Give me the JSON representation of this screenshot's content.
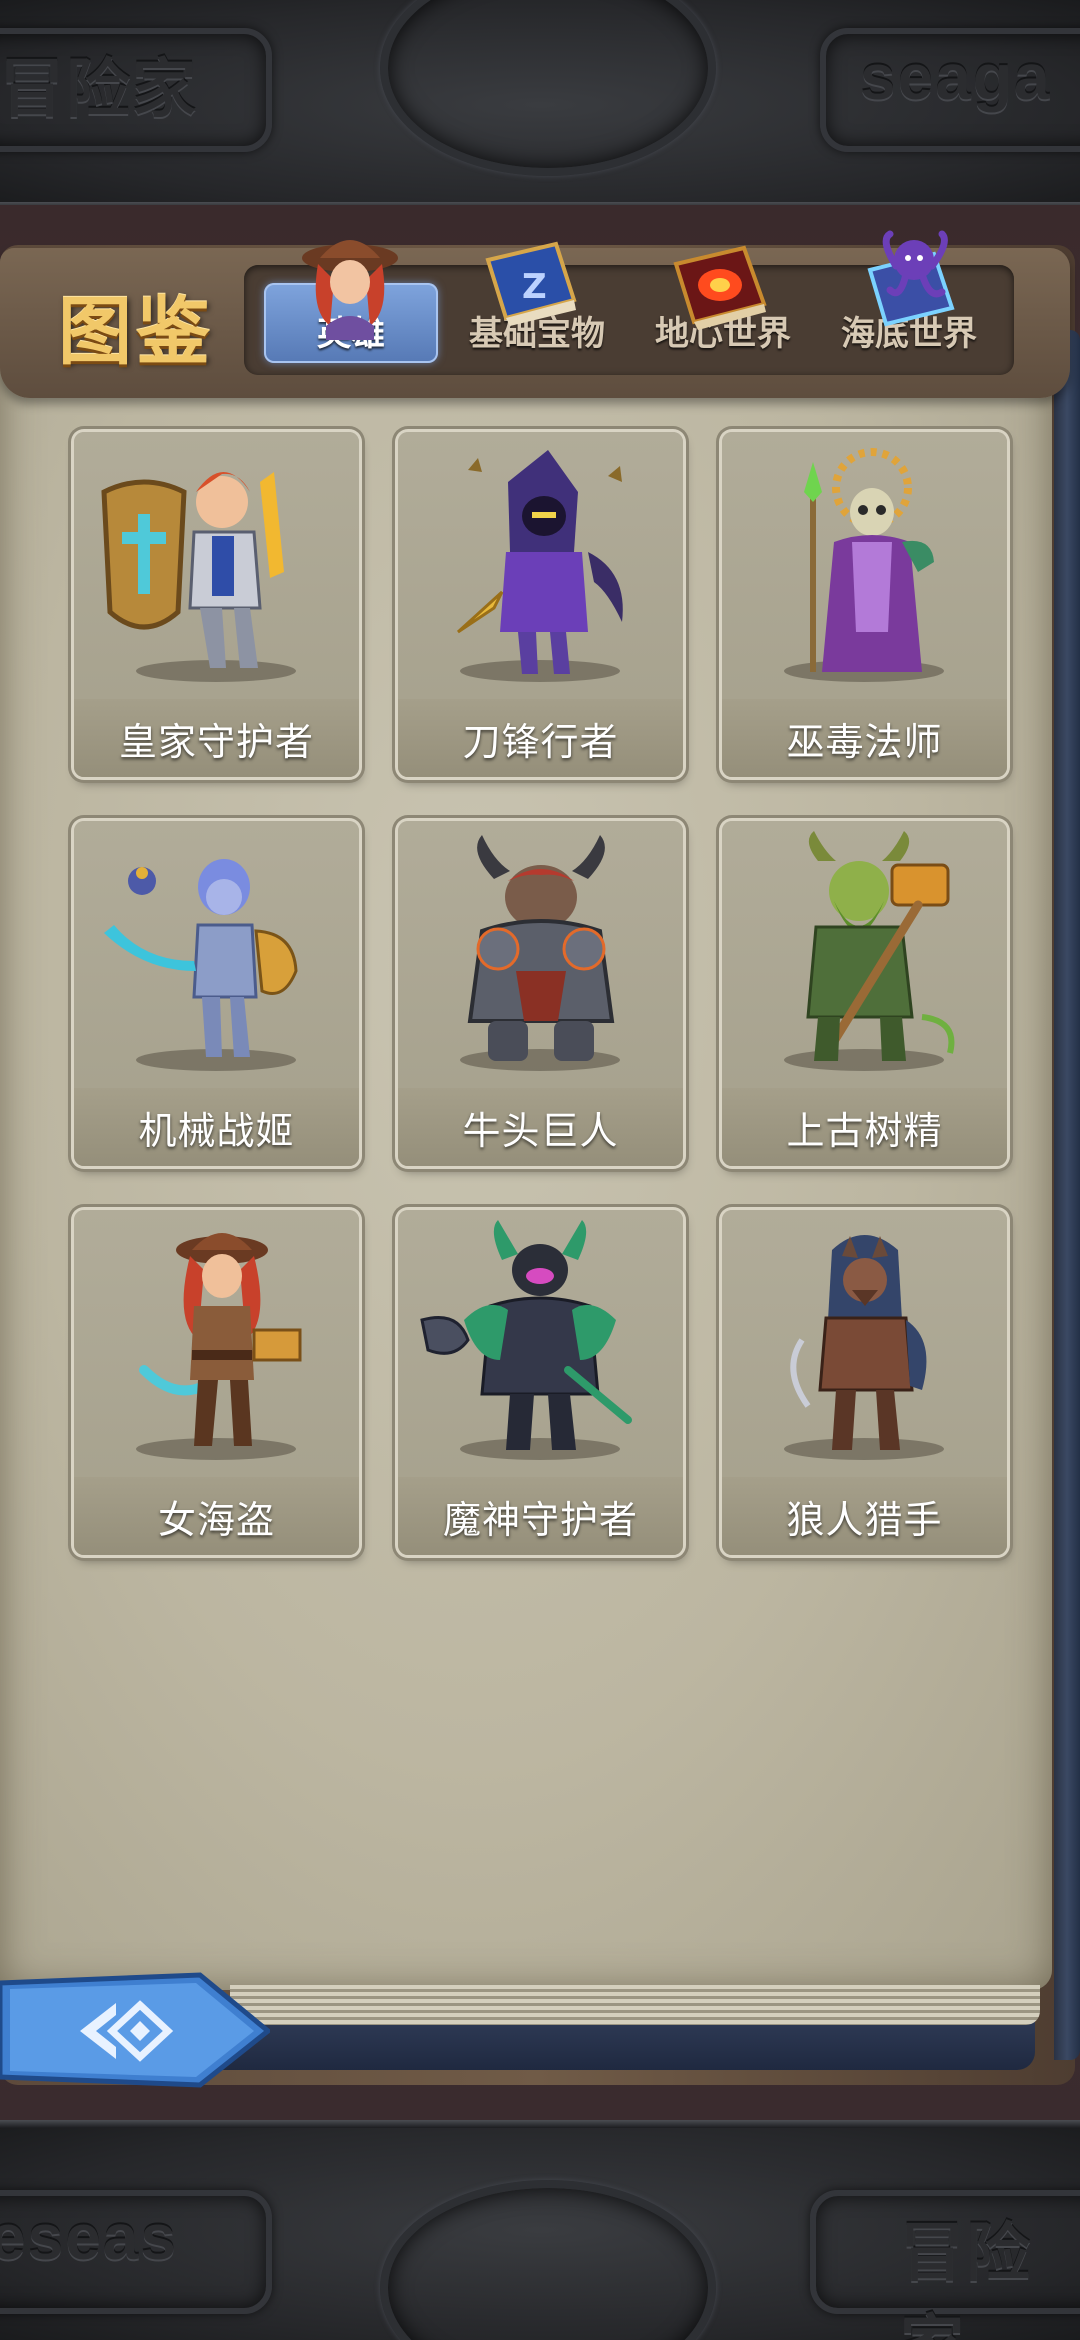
{
  "header": {
    "title": "图鉴"
  },
  "tabs": [
    {
      "label": "英雄",
      "active": true,
      "icon": "pirate-heroine-icon"
    },
    {
      "label": "基础宝物",
      "active": false,
      "icon": "spellbook-icon"
    },
    {
      "label": "地心世界",
      "active": false,
      "icon": "fire-tome-icon"
    },
    {
      "label": "海底世界",
      "active": false,
      "icon": "octopus-tome-icon"
    }
  ],
  "heroes": [
    {
      "name": "皇家守护者",
      "icon": "royal-guardian-portrait"
    },
    {
      "name": "刀锋行者",
      "icon": "blade-walker-portrait"
    },
    {
      "name": "巫毒法师",
      "icon": "voodoo-mage-portrait"
    },
    {
      "name": "机械战姬",
      "icon": "mech-warrior-portrait"
    },
    {
      "name": "牛头巨人",
      "icon": "minotaur-giant-portrait"
    },
    {
      "name": "上古树精",
      "icon": "ancient-treant-portrait"
    },
    {
      "name": "女海盗",
      "icon": "pirate-girl-portrait"
    },
    {
      "name": "魔神守护者",
      "icon": "demon-guardian-portrait"
    },
    {
      "name": "狼人猎手",
      "icon": "werewolf-hunter-portrait"
    }
  ],
  "background": {
    "top_left_relief": "冒险家",
    "top_right_relief": "seaga",
    "bottom_left_relief": "eseas",
    "bottom_right_relief": "冒险家"
  },
  "colors": {
    "title_gold": "#f1c869",
    "tab_active_blue": "#5679b5",
    "page_parchment": "#bcb6a1",
    "card_bg": "#aca793"
  },
  "back_button": {
    "icon": "back-diamond-icon"
  }
}
